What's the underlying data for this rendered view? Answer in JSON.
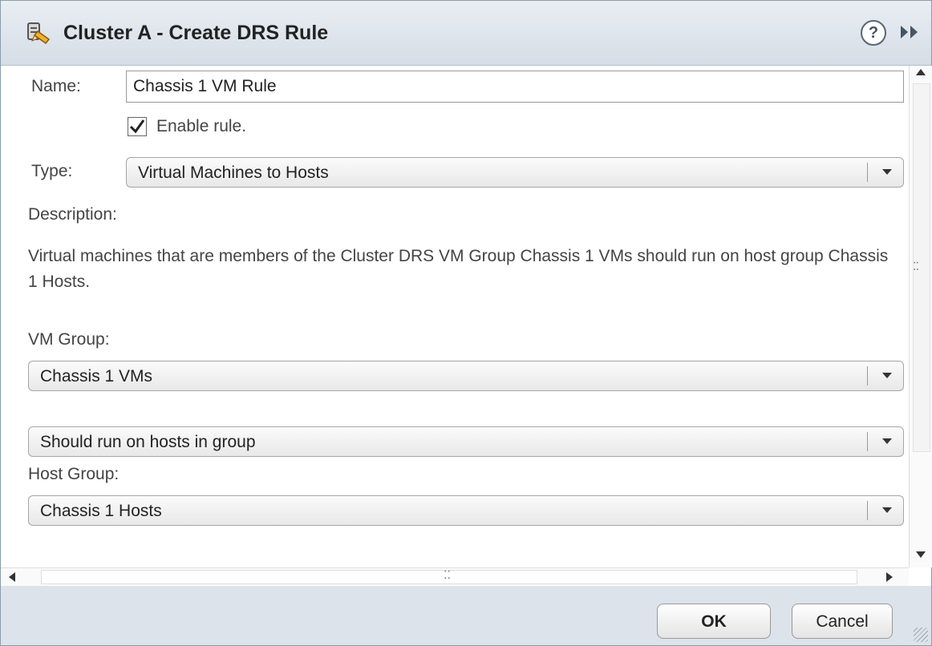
{
  "dialog": {
    "title": "Cluster A - Create DRS Rule",
    "help_label": "?"
  },
  "form": {
    "name_label": "Name:",
    "name_value": "Chassis 1 VM Rule",
    "enable_label": "Enable rule.",
    "enable_checked": true,
    "type_label": "Type:",
    "type_value": "Virtual Machines to Hosts",
    "description_label": "Description:",
    "description_text": "Virtual machines that are members of the Cluster DRS VM Group Chassis 1 VMs should run on host group Chassis 1 Hosts.",
    "vm_group_label": "VM Group:",
    "vm_group_value": "Chassis 1 VMs",
    "rule_value": "Should run on hosts in group",
    "host_group_label": "Host Group:",
    "host_group_value": "Chassis 1 Hosts"
  },
  "buttons": {
    "ok": "OK",
    "cancel": "Cancel"
  },
  "colors": {
    "titlebar": "#dfe6ed",
    "footer": "#dde3ea",
    "border": "#8a9aab"
  }
}
